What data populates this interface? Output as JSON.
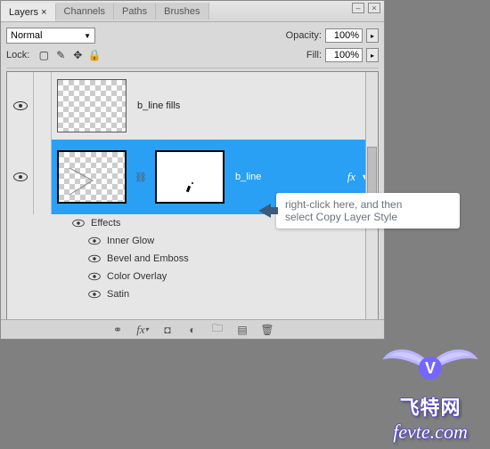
{
  "tabs": {
    "layers": "Layers",
    "channels": "Channels",
    "paths": "Paths",
    "brushes": "Brushes"
  },
  "blend": {
    "mode": "Normal",
    "opacity_label": "Opacity:",
    "opacity_value": "100%"
  },
  "lock": {
    "label": "Lock:",
    "fill_label": "Fill:",
    "fill_value": "100%"
  },
  "layers": {
    "row1": {
      "name": "b_line fills"
    },
    "row2": {
      "name": "b_line",
      "fx": "fx"
    }
  },
  "effects": {
    "title": "Effects",
    "items": [
      "Inner Glow",
      "Bevel and Emboss",
      "Color Overlay",
      "Satin"
    ]
  },
  "callout": {
    "line1": "right-click here, and then",
    "line2": "select Copy Layer Style"
  },
  "logo": {
    "cn": "飞特网",
    "en": "fevte.com"
  }
}
